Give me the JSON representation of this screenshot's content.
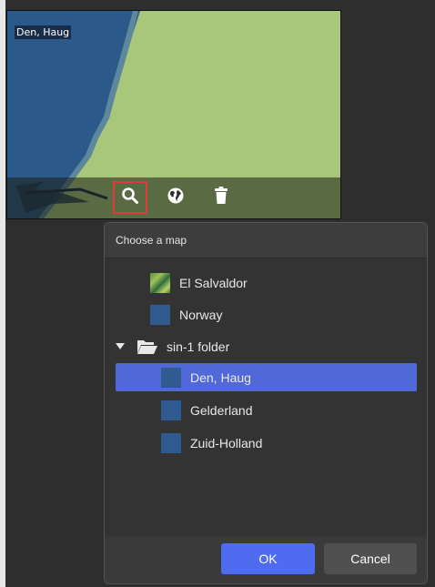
{
  "preview": {
    "label": "Den, Haug",
    "toolbar": {
      "search_icon": "search-icon",
      "globe_icon": "globe-icon",
      "trash_icon": "trash-icon"
    }
  },
  "dialog": {
    "title": "Choose a map",
    "items": [
      {
        "label": "El Salvaldor",
        "icon": "map-thumbnail"
      },
      {
        "label": "Norway",
        "icon": "map-swatch"
      },
      {
        "label": "sin-1 folder",
        "icon": "folder-icon",
        "expanded": true
      },
      {
        "label": "Den, Haug",
        "icon": "map-swatch",
        "selected": true
      },
      {
        "label": "Gelderland",
        "icon": "map-swatch"
      },
      {
        "label": "Zuid-Holland",
        "icon": "map-swatch"
      }
    ],
    "ok_label": "OK",
    "cancel_label": "Cancel"
  },
  "colors": {
    "accent": "#4f6bf0",
    "selection": "#5068d8",
    "swatch": "#2f5b91",
    "highlight_border": "#e03b3b"
  }
}
